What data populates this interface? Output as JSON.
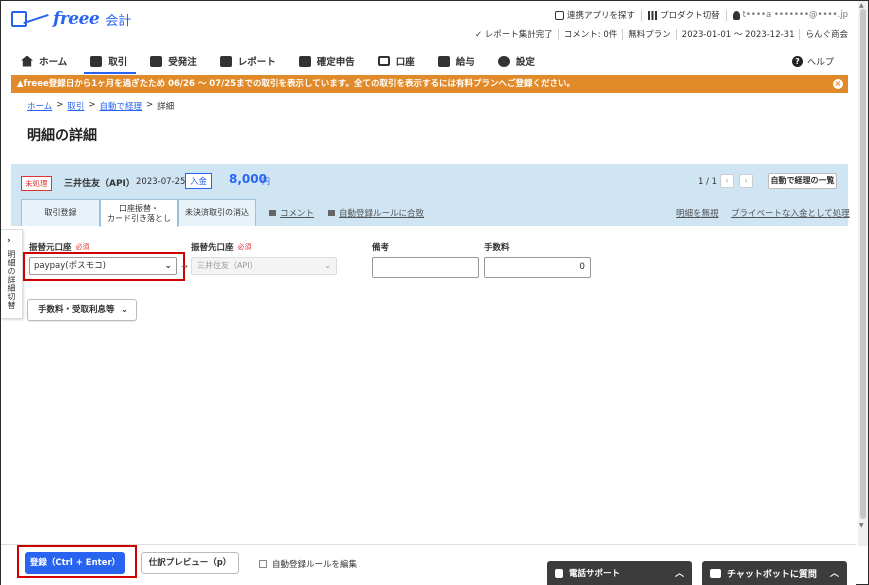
{
  "app": {
    "brand": "freee",
    "product": "会計"
  },
  "header": {
    "links": [
      "連携アプリを探す",
      "プロダクト切替",
      "t••••a •••••••@••••.jp"
    ],
    "status": [
      "レポート集計完了",
      "コメント: 0件",
      "無料プラン",
      "2023-01-01 ～ 2023-12-31",
      "らんぐ商会"
    ]
  },
  "nav": {
    "items": [
      "ホーム",
      "取引",
      "受発注",
      "レポート",
      "確定申告",
      "口座",
      "給与",
      "設定"
    ],
    "help": "ヘルプ"
  },
  "banner": {
    "text": "freee登録日から1ヶ月を過ぎたため 06/26 ～ 07/25までの取引を表示しています。全ての取引を表示するには有料プランへご登録ください。"
  },
  "breadcrumb": [
    "ホーム",
    "取引",
    "自動で経理",
    "詳細"
  ],
  "page": {
    "title": "明細の詳細"
  },
  "detail": {
    "badge": "未処理",
    "bank": "三井住友（API）",
    "date": "2023-07-25",
    "inout": "入金",
    "amount": "8,000",
    "currency": "円",
    "pager": "1 / 1",
    "list_button": "自動で経理の一覧",
    "tabs": [
      "取引登録",
      "口座振替・\nカード引き落とし",
      "未決済取引の消込"
    ],
    "tab_links": [
      "コメント",
      "自動登録ルールに合致"
    ],
    "right_links": [
      "明細を無視",
      "プライベートな入金として処理"
    ]
  },
  "side_panel": {
    "label": "明細の詳細切替"
  },
  "form": {
    "from_label": "振替元口座",
    "to_label": "振替先口座",
    "required": "必須",
    "from_value": "paypay(ポスモコ)",
    "to_value": "三井住友（API）",
    "memo_label": "備考",
    "memo_value": "",
    "fee_label": "手数料",
    "fee_value": "0",
    "fee_button": "手数料・受取利息等"
  },
  "footer": {
    "register": "登録（Ctrl + Enter）",
    "preview": "仕訳プレビュー（p）",
    "checkbox": "自動登録ルールを編集",
    "support": "電話サポート",
    "chat": "チャットボットに質問"
  },
  "colors": {
    "accent": "#2864f0",
    "banner": "#e18a2a",
    "panel": "#cfe5f3",
    "highlight": "#d10000"
  }
}
